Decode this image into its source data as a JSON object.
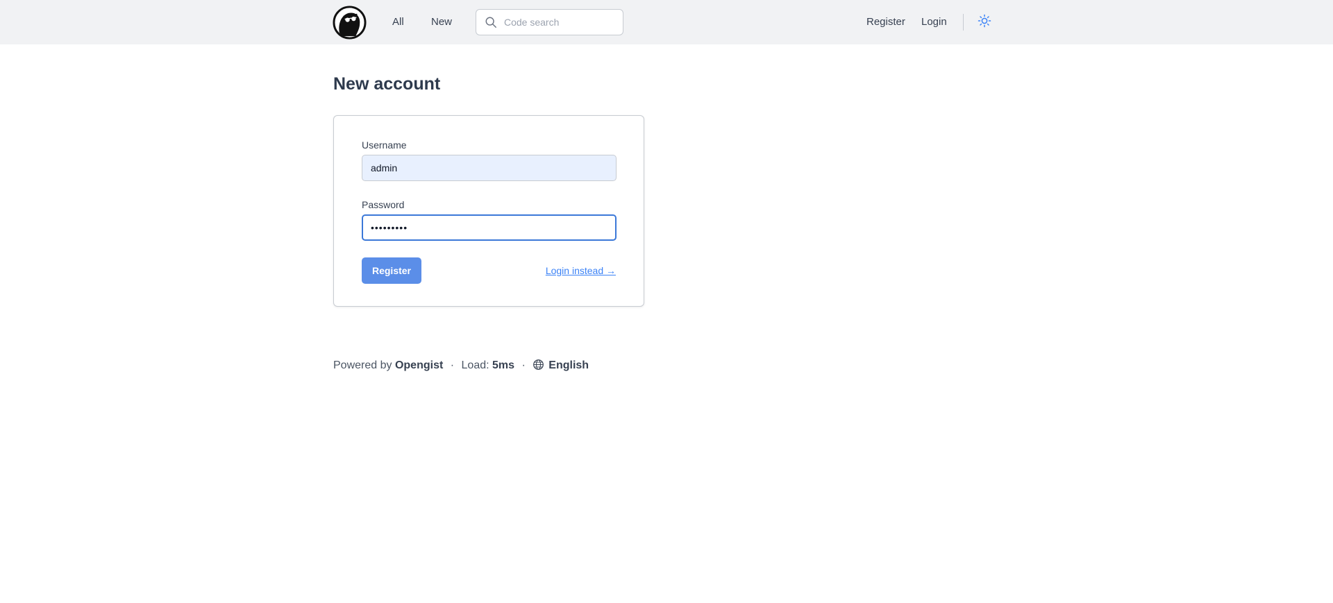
{
  "header": {
    "nav_all": "All",
    "nav_new": "New",
    "search_placeholder": "Code search",
    "register_link": "Register",
    "login_link": "Login",
    "logo_icon": "opengist-logo",
    "theme_icon": "sun-icon"
  },
  "main": {
    "title": "New account",
    "form": {
      "username_label": "Username",
      "username_value": "admin",
      "password_label": "Password",
      "password_value": "•••••••••",
      "submit_label": "Register",
      "login_instead": "Login instead →"
    }
  },
  "footer": {
    "powered_by": "Powered by",
    "brand": "Opengist",
    "separator": "·",
    "load_label": "Load:",
    "load_value": "5ms",
    "language": "English"
  },
  "colors": {
    "header_bg": "#f1f2f4",
    "accent": "#5b8ee8",
    "link": "#3b82f6",
    "title": "#2e3a4d"
  }
}
